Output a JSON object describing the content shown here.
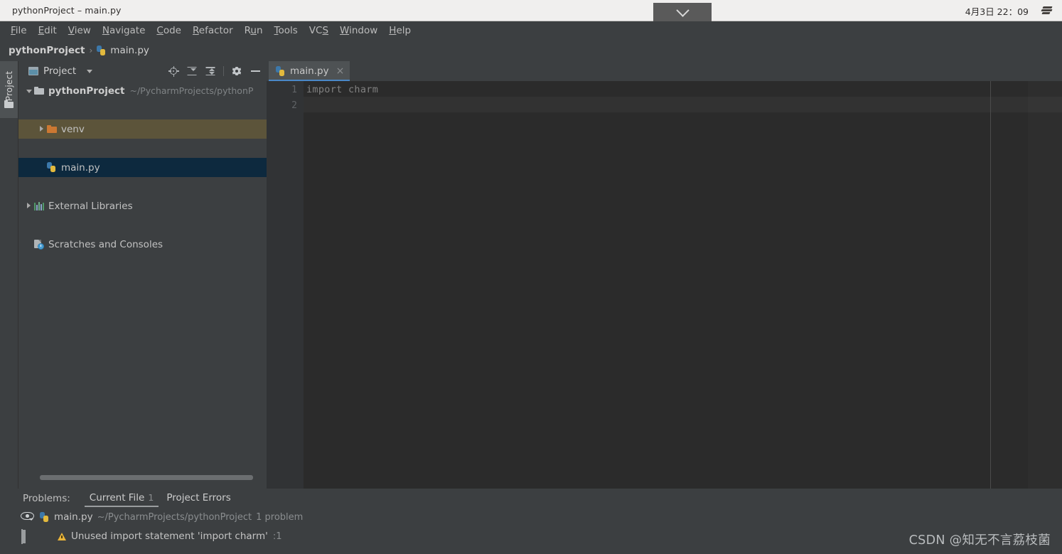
{
  "titlebar": {
    "title": "pythonProject – main.py",
    "clock": "4月3日  22：09",
    "dropdown_icon": "chevron-down-icon",
    "tray_icon": "input-method-icon"
  },
  "menubar": {
    "items": [
      {
        "label": "File",
        "mnemonic": "F"
      },
      {
        "label": "Edit",
        "mnemonic": "E"
      },
      {
        "label": "View",
        "mnemonic": "V"
      },
      {
        "label": "Navigate",
        "mnemonic": "N"
      },
      {
        "label": "Code",
        "mnemonic": "C"
      },
      {
        "label": "Refactor",
        "mnemonic": "R"
      },
      {
        "label": "Run",
        "mnemonic": "u"
      },
      {
        "label": "Tools",
        "mnemonic": "T"
      },
      {
        "label": "VCS",
        "mnemonic": "S"
      },
      {
        "label": "Window",
        "mnemonic": "W"
      },
      {
        "label": "Help",
        "mnemonic": "H"
      }
    ]
  },
  "breadcrumb": {
    "project": "pythonProject",
    "separator": "›",
    "file": "main.py",
    "file_icon": "python-file-icon"
  },
  "left_strip": {
    "tab_label": "Project",
    "folder_icon": "folder-icon"
  },
  "project_panel": {
    "title": "Project",
    "window_icon": "tool-window-icon",
    "caret_icon": "chevron-down-icon",
    "toolbar": [
      {
        "name": "locate-file-button",
        "icon": "crosshair-target-icon"
      },
      {
        "name": "expand-all-button",
        "icon": "expand-all-icon"
      },
      {
        "name": "collapse-all-button",
        "icon": "collapse-all-icon"
      },
      {
        "name": "settings-button",
        "icon": "gear-icon"
      },
      {
        "name": "hide-button",
        "icon": "minus-icon"
      }
    ],
    "tree": [
      {
        "label": "pythonProject",
        "path": "~/PycharmProjects/pythonP",
        "icon": "folder-gray-icon",
        "arrow": "down",
        "state": "normal",
        "bold": true
      },
      {
        "label": "venv",
        "path": "",
        "icon": "folder-orange-icon",
        "arrow": "right",
        "state": "hovered",
        "bold": false
      },
      {
        "label": "main.py",
        "path": "",
        "icon": "python-file-icon",
        "arrow": "none",
        "state": "selected",
        "bold": false
      },
      {
        "label": "External Libraries",
        "path": "",
        "icon": "libraries-icon",
        "arrow": "right",
        "state": "normal",
        "bold": false
      },
      {
        "label": "Scratches and Consoles",
        "path": "",
        "icon": "scratches-icon",
        "arrow": "none",
        "state": "normal",
        "bold": false
      }
    ]
  },
  "editor": {
    "tab": {
      "label": "main.py",
      "icon": "python-file-icon",
      "close_icon": "close-icon"
    },
    "line_numbers": [
      "1",
      "2"
    ],
    "code_lines": [
      "import charm",
      ""
    ],
    "cursor_line": 2
  },
  "problems": {
    "label": "Problems:",
    "tabs": [
      {
        "label": "Current File",
        "count": "1",
        "active": true
      },
      {
        "label": "Project Errors",
        "count": "",
        "active": false
      }
    ],
    "gutter": [
      {
        "name": "inspections-eye-button",
        "icon": "eye-icon"
      },
      {
        "name": "preview-split-button",
        "icon": "split-view-icon"
      },
      {
        "name": "hide-panel-button",
        "icon": "minus-icon"
      }
    ],
    "file_row": {
      "icon": "python-file-icon",
      "name": "main.py",
      "path": "~/PycharmProjects/pythonProject",
      "count": "1 problem"
    },
    "item_row": {
      "icon": "warning-triangle-icon",
      "message": "Unused import statement 'import charm'",
      "line_ref": ":1"
    }
  },
  "watermark": {
    "text": "CSDN @知无不言荔枝菌"
  },
  "colors": {
    "titlebar_bg": "#f0efee",
    "ide_bg": "#3c3f41",
    "editor_bg": "#2b2b2b",
    "gutter_bg": "#313335",
    "selection_blue": "#0d293e",
    "hover_olive": "#5c543a",
    "tab_underline": "#4a88c7",
    "warning_yellow": "#e8b339",
    "folder_orange": "#cc7832"
  }
}
